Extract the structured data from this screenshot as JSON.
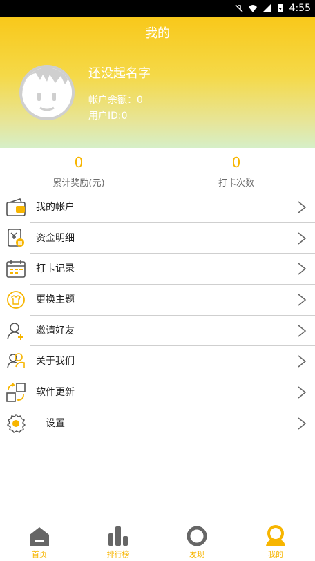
{
  "status_bar": {
    "time": "4:55"
  },
  "header": {
    "title": "我的",
    "profile": {
      "name": "还没起名字",
      "balance": "帐户余额：0",
      "user_id": "用户ID:0"
    }
  },
  "stats": [
    {
      "value": "0",
      "label": "累计奖励(元)"
    },
    {
      "value": "0",
      "label": "打卡次数"
    }
  ],
  "menu": [
    {
      "label": "我的帐户",
      "icon": "wallet-icon"
    },
    {
      "label": "资金明细",
      "icon": "fund-detail-icon"
    },
    {
      "label": "打卡记录",
      "icon": "calendar-icon"
    },
    {
      "label": "更换主题",
      "icon": "theme-shirt-icon"
    },
    {
      "label": "邀请好友",
      "icon": "invite-friend-icon"
    },
    {
      "label": "关于我们",
      "icon": "about-us-icon"
    },
    {
      "label": "软件更新",
      "icon": "software-update-icon"
    },
    {
      "label": "设置",
      "icon": "settings-gear-icon"
    }
  ],
  "tabbar": [
    {
      "label": "首页",
      "icon": "home-icon"
    },
    {
      "label": "排行榜",
      "icon": "ranking-icon"
    },
    {
      "label": "发现",
      "icon": "discover-icon"
    },
    {
      "label": "我的",
      "icon": "profile-icon"
    }
  ],
  "colors": {
    "accent": "#f7b500",
    "header_top": "#f8c81a",
    "header_bottom": "#d6efc7"
  }
}
